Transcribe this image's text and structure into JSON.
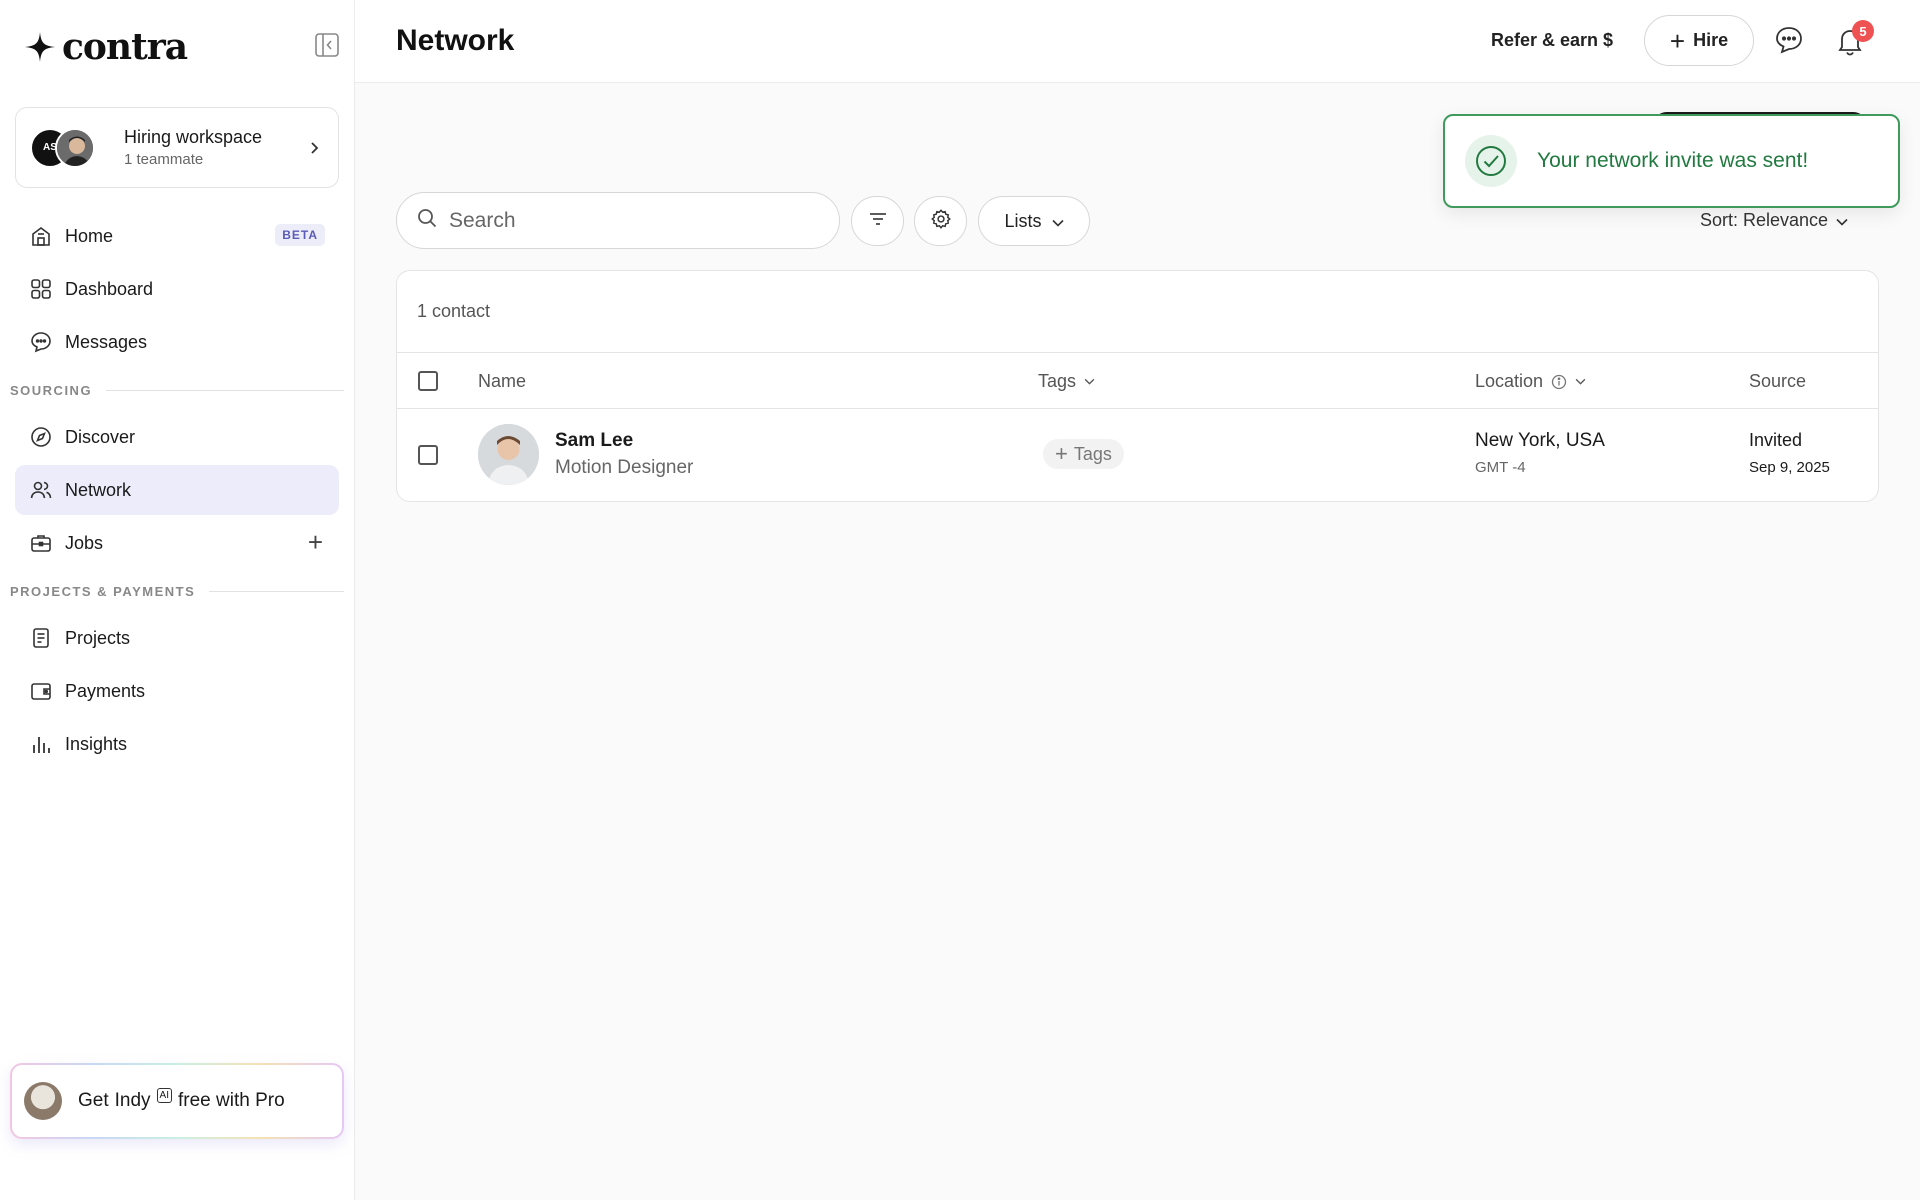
{
  "brand": {
    "name": "contra"
  },
  "workspace": {
    "title": "Hiring workspace",
    "subtitle": "1 teammate",
    "avatar_initials": "AS"
  },
  "sidebar": {
    "items": [
      {
        "label": "Home",
        "icon": "home-icon",
        "badge": "BETA"
      },
      {
        "label": "Dashboard",
        "icon": "grid-icon"
      },
      {
        "label": "Messages",
        "icon": "chat-icon"
      },
      {
        "label": "Discover",
        "icon": "compass-icon"
      },
      {
        "label": "Network",
        "icon": "users-icon",
        "active": true
      },
      {
        "label": "Jobs",
        "icon": "briefcase-icon"
      },
      {
        "label": "Projects",
        "icon": "document-icon"
      },
      {
        "label": "Payments",
        "icon": "wallet-icon"
      },
      {
        "label": "Insights",
        "icon": "bar-chart-icon"
      }
    ],
    "sections": {
      "sourcing": "SOURCING",
      "projects_payments": "PROJECTS & PAYMENTS"
    },
    "promo": {
      "prefix": "Get",
      "name": "Indy",
      "ai": "AI",
      "suffix": "free with Pro"
    }
  },
  "header": {
    "title": "Network",
    "refer": "Refer & earn $",
    "hire": "Hire",
    "notification_count": "5"
  },
  "toolbar": {
    "search_placeholder": "Search",
    "lists_label": "Lists",
    "sort_label": "Sort: Relevance"
  },
  "toast": {
    "message": "Your network invite was sent!"
  },
  "table": {
    "count_label": "1 contact",
    "columns": {
      "name": "Name",
      "tags": "Tags",
      "location": "Location",
      "source": "Source"
    },
    "rows": [
      {
        "name": "Sam Lee",
        "role": "Motion Designer",
        "tags_button": "Tags",
        "location": "New York, USA",
        "timezone": "GMT -4",
        "source": "Invited",
        "source_date": "Sep 9, 2025"
      }
    ]
  },
  "colors": {
    "accent_active": "#ececfb",
    "toast_green": "#227a40",
    "badge_red": "#ef5252"
  }
}
